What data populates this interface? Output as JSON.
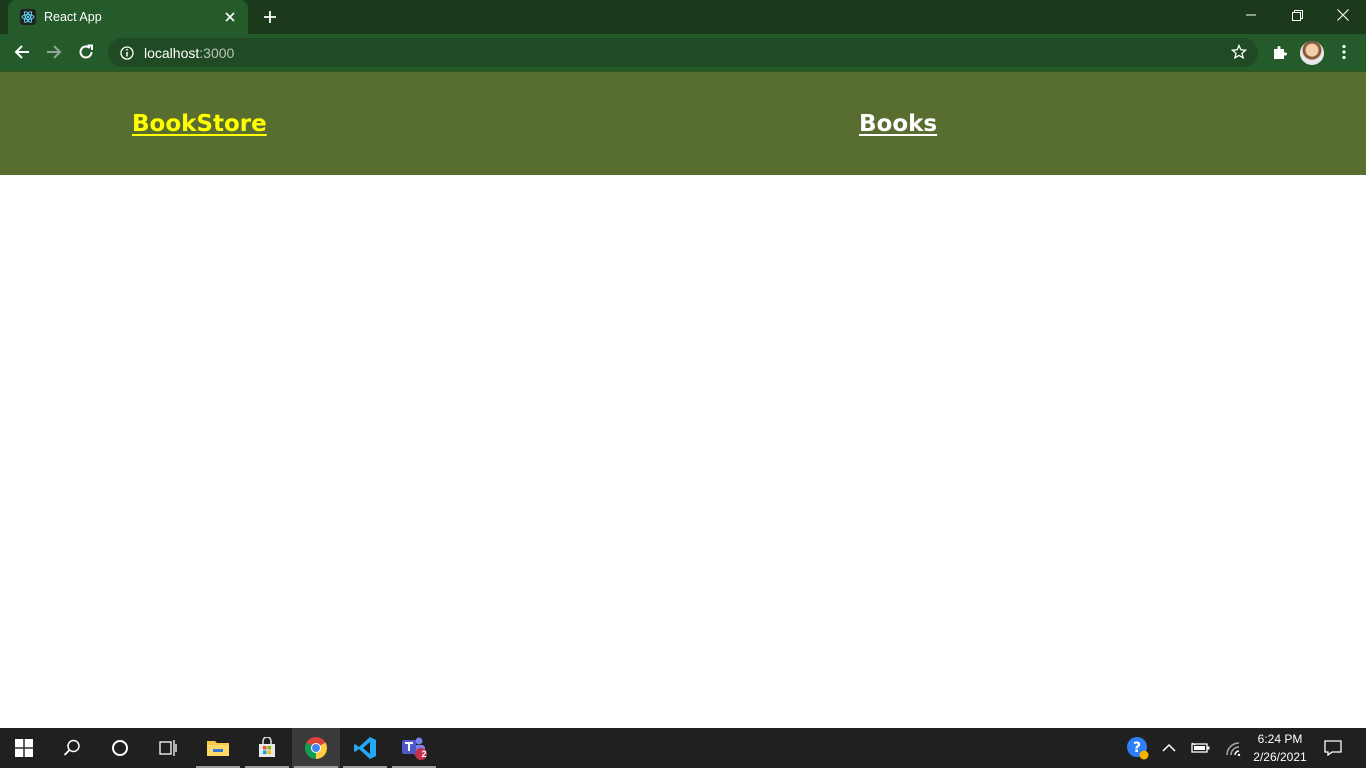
{
  "browser": {
    "tab_title": "React App",
    "url_host": "localhost",
    "url_port": ":3000"
  },
  "page": {
    "brand": "BookStore",
    "nav_books": "Books"
  },
  "taskbar": {
    "time": "6:24 PM",
    "date": "2/26/2021",
    "teams_badge": "2"
  },
  "colors": {
    "navbar_bg": "#586e31",
    "brand_color": "#ffff00",
    "chrome_frame": "#1b3a1c",
    "chrome_toolbar": "#255a2a"
  }
}
